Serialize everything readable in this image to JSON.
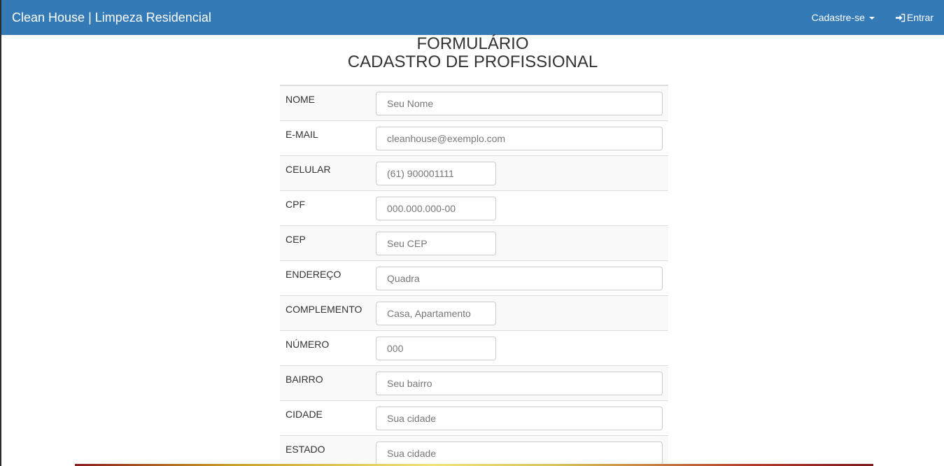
{
  "navbar": {
    "brand": "Clean House | Limpeza Residencial",
    "signup_label": "Cadastre-se",
    "login_label": "Entrar",
    "color": "#337ab7"
  },
  "page": {
    "title_line1": "FORMULÁRIO",
    "title_line2": "CADASTRO DE PROFISSIONAL"
  },
  "form": {
    "fields": [
      {
        "label": "NOME",
        "placeholder": "Seu Nome",
        "value": ""
      },
      {
        "label": "E-MAIL",
        "placeholder": "cleanhouse@exemplo.com",
        "value": ""
      },
      {
        "label": "CELULAR",
        "placeholder": "(61) 900001111",
        "value": ""
      },
      {
        "label": "CPF",
        "placeholder": "000.000.000-00",
        "value": ""
      },
      {
        "label": "CEP",
        "placeholder": "Seu CEP",
        "value": ""
      },
      {
        "label": "ENDEREÇO",
        "placeholder": "Quadra",
        "value": ""
      },
      {
        "label": "COMPLEMENTO",
        "placeholder": "Casa, Apartamento",
        "value": ""
      },
      {
        "label": "NÚMERO",
        "placeholder": "000",
        "value": ""
      },
      {
        "label": "BAIRRO",
        "placeholder": "Seu bairro",
        "value": ""
      },
      {
        "label": "CIDADE",
        "placeholder": "Sua cidade",
        "value": ""
      },
      {
        "label": "ESTADO",
        "placeholder": "Sua cidade",
        "value": ""
      }
    ]
  }
}
